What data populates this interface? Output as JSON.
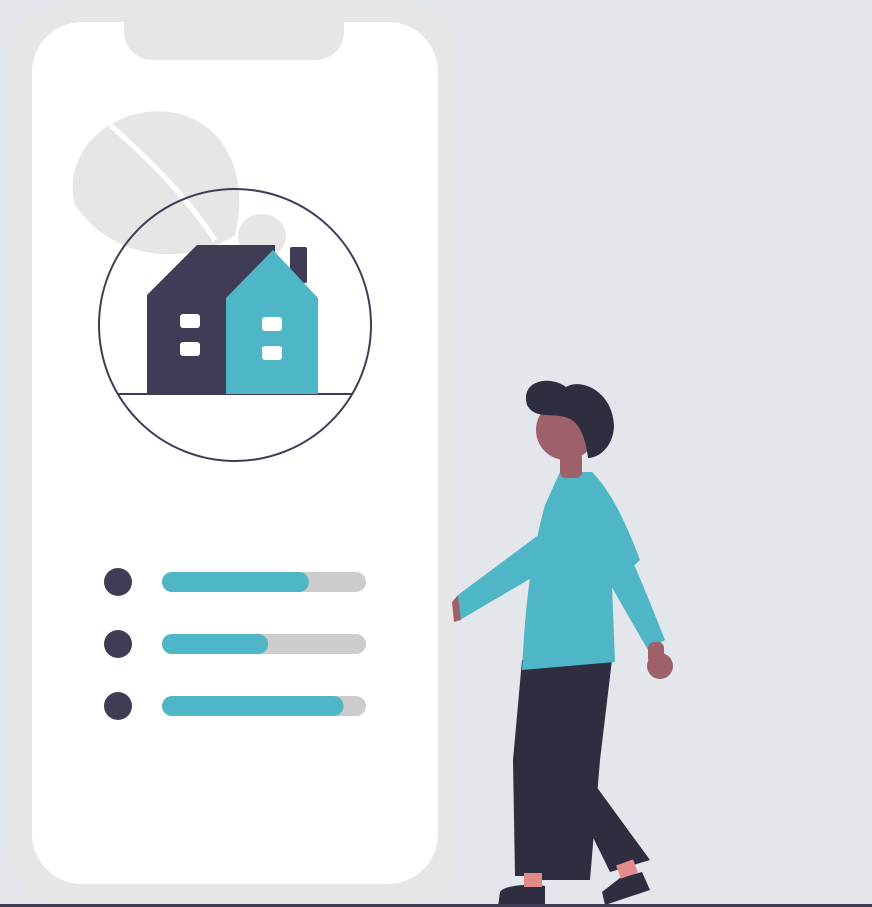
{
  "colors": {
    "background": "#e3e7eb",
    "phone_frame": "#e6e6e6",
    "phone_screen": "#ffffff",
    "notch": "#e6e6e6",
    "dark": "#3f3d56",
    "accent": "#4eb6c7",
    "track": "#cccccc",
    "skin": "#9e616a",
    "hair": "#2f2e41",
    "pants": "#2f2e41",
    "leaf": "#e6e6e6"
  },
  "illustration": {
    "house_icon": "house-icon",
    "leaf_icon": "leaf-icon",
    "person": "person-illustration"
  },
  "list_items": [
    {
      "progress": 0.72
    },
    {
      "progress": 0.52
    },
    {
      "progress": 0.89
    }
  ]
}
